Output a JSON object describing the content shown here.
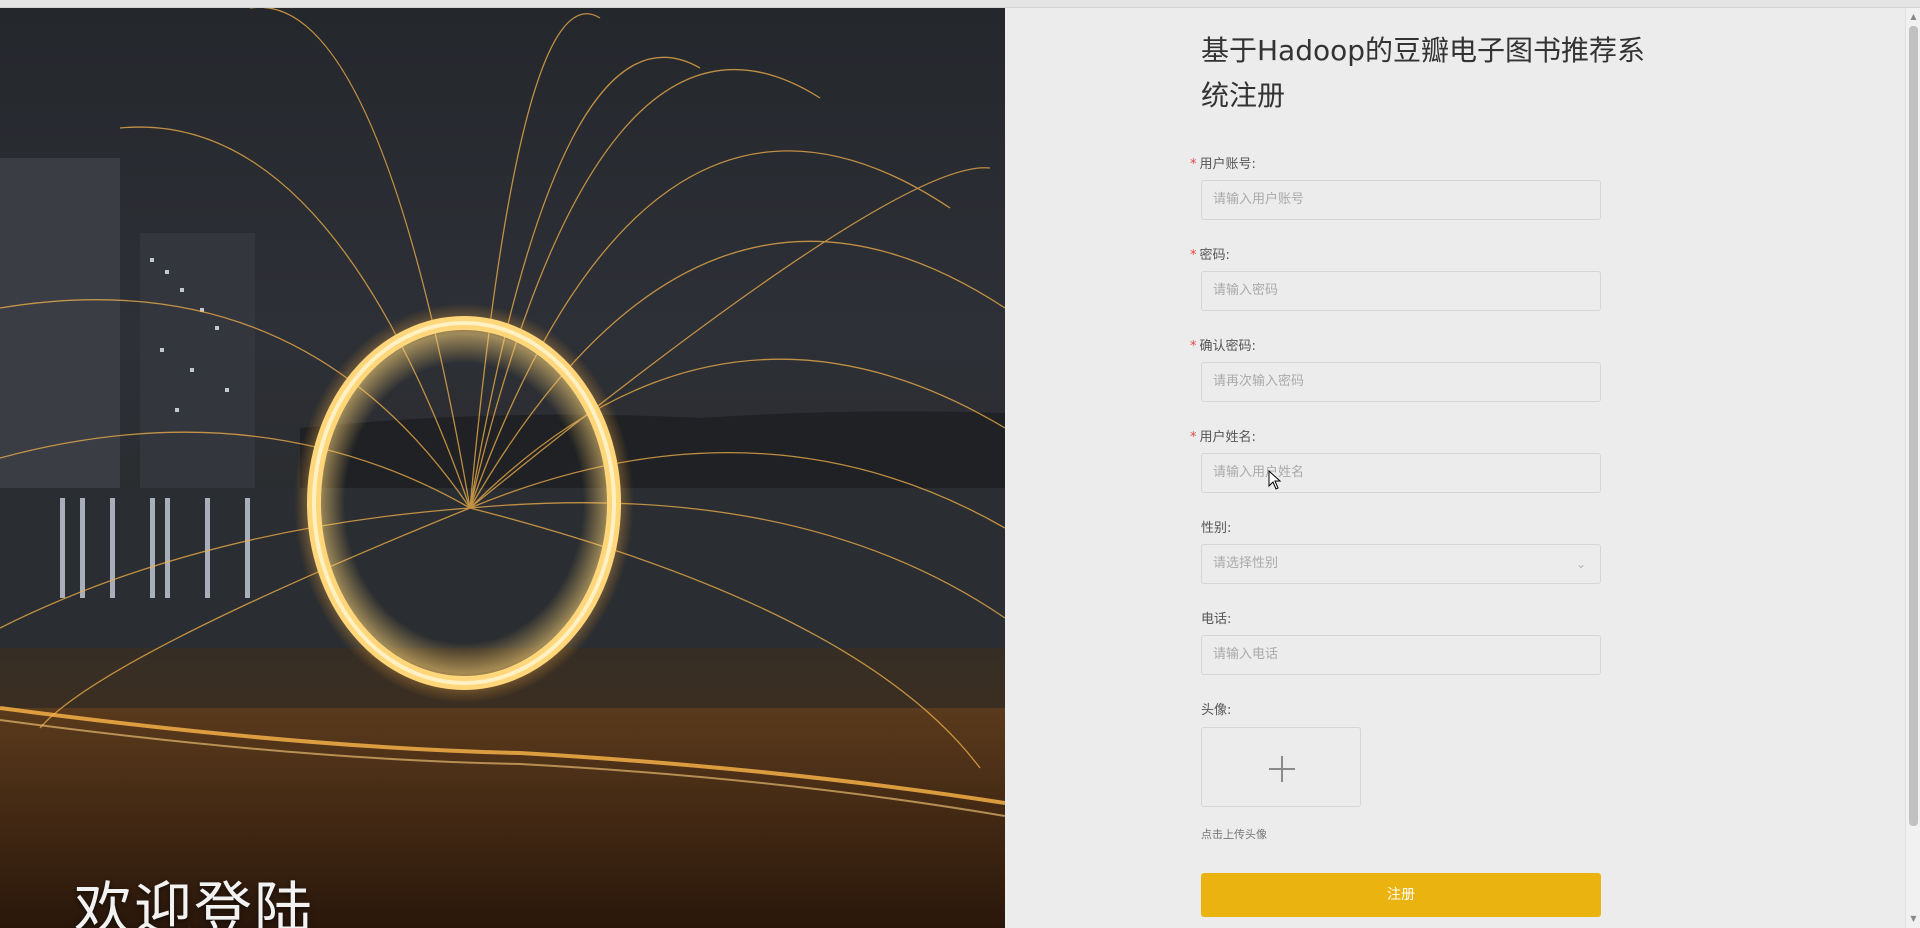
{
  "hero": {
    "title": "欢迎登陆"
  },
  "form": {
    "title": "基于Hadoop的豆瓣电子图书推荐系统注册",
    "required_mark": "*",
    "fields": [
      {
        "label": "用户账号:",
        "placeholder": "请输入用户账号",
        "required": true
      },
      {
        "label": "密码:",
        "placeholder": "请输入密码",
        "required": true
      },
      {
        "label": "确认密码:",
        "placeholder": "请再次输入密码",
        "required": true
      },
      {
        "label": "用户姓名:",
        "placeholder": "请输入用户姓名",
        "required": true
      },
      {
        "label": "性别:",
        "placeholder": "请选择性别",
        "required": false,
        "type": "select"
      },
      {
        "label": "电话:",
        "placeholder": "请输入电话",
        "required": false
      }
    ],
    "avatar": {
      "label": "头像:",
      "hint": "点击上传头像"
    },
    "submit_label": "注册"
  },
  "colors": {
    "accent": "#eab30f",
    "required": "#e64545",
    "background": "#ececec"
  }
}
